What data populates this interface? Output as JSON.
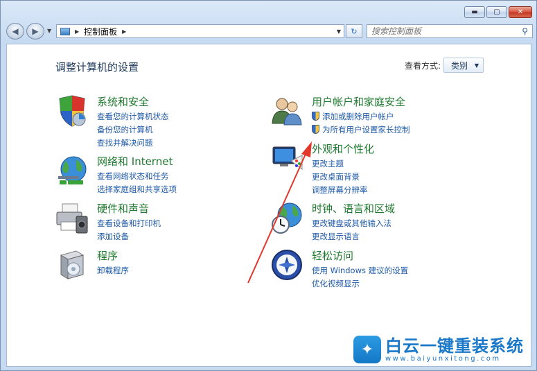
{
  "window": {
    "caption": {
      "minimize": "▬",
      "maximize": "▢",
      "close": "✕"
    }
  },
  "nav": {
    "back": "◀",
    "forward": "▶",
    "breadcrumb": [
      "控制面板"
    ],
    "search_placeholder": "搜索控制面板",
    "refresh": "↻"
  },
  "main": {
    "title": "调整计算机的设置",
    "viewby_label": "查看方式:",
    "viewby_value": "类别"
  },
  "categories_left": [
    {
      "title": "系统和安全",
      "links": [
        "查看您的计算机状态",
        "备份您的计算机",
        "查找并解决问题"
      ]
    },
    {
      "title": "网络和 Internet",
      "links": [
        "查看网络状态和任务",
        "选择家庭组和共享选项"
      ]
    },
    {
      "title": "硬件和声音",
      "links": [
        "查看设备和打印机",
        "添加设备"
      ]
    },
    {
      "title": "程序",
      "links": [
        "卸载程序"
      ]
    }
  ],
  "categories_right": [
    {
      "title": "用户帐户和家庭安全",
      "links": [
        "添加或删除用户帐户",
        "为所有用户设置家长控制"
      ]
    },
    {
      "title": "外观和个性化",
      "links": [
        "更改主题",
        "更改桌面背景",
        "调整屏幕分辨率"
      ]
    },
    {
      "title": "时钟、语言和区域",
      "links": [
        "更改键盘或其他输入法",
        "更改显示语言"
      ]
    },
    {
      "title": "轻松访问",
      "links": [
        "使用 Windows 建议的设置",
        "优化视频显示"
      ]
    }
  ],
  "watermark": {
    "brand": "白云一键重装系统",
    "url": "www.baiyunxitong.com"
  },
  "colors": {
    "category_title": "#1e7a2e",
    "link": "#1e5aa8",
    "annotation_arrow": "#e2372b"
  }
}
